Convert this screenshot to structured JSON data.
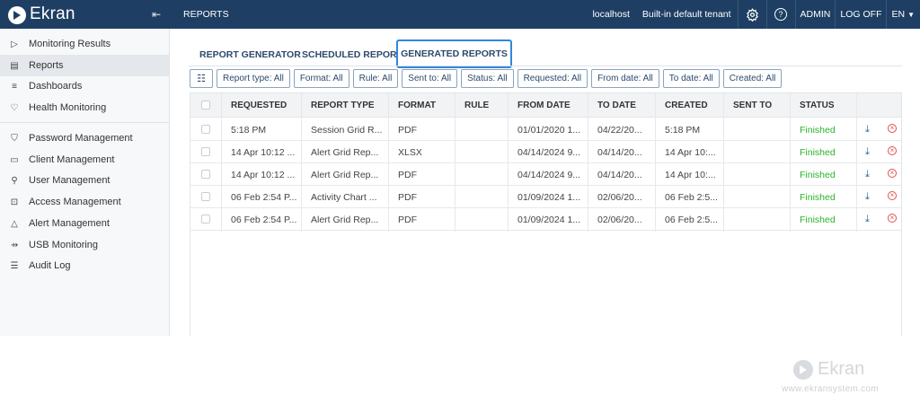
{
  "app": {
    "logo": "Ekran",
    "page_title": "REPORTS"
  },
  "topbar": {
    "host": "localhost",
    "tenant": "Built-in default tenant",
    "settings_icon": "gear-icon",
    "help_icon": "question-circle-icon",
    "admin": "ADMIN",
    "logoff": "LOG OFF",
    "language": "EN"
  },
  "sidebar": {
    "items": [
      {
        "label": "Monitoring Results",
        "icon": "play-outline-icon"
      },
      {
        "label": "Reports",
        "icon": "document-icon"
      },
      {
        "label": "Dashboards",
        "icon": "bar-chart-icon"
      },
      {
        "label": "Health Monitoring",
        "icon": "heart-icon"
      },
      {
        "label": "Password Management",
        "icon": "shield-icon"
      },
      {
        "label": "Client Management",
        "icon": "monitor-icon"
      },
      {
        "label": "User Management",
        "icon": "user-icon"
      },
      {
        "label": "Access Management",
        "icon": "lock-icon"
      },
      {
        "label": "Alert Management",
        "icon": "bell-icon"
      },
      {
        "label": "USB Monitoring",
        "icon": "usb-icon"
      },
      {
        "label": "Audit Log",
        "icon": "list-icon"
      }
    ]
  },
  "tabs": [
    {
      "label": "REPORT GENERATOR"
    },
    {
      "label": "SCHEDULED REPORTS"
    },
    {
      "label": "GENERATED REPORTS"
    }
  ],
  "filters": [
    "Report type: All",
    "Format: All",
    "Rule: All",
    "Sent to: All",
    "Status: All",
    "Requested: All",
    "From date: All",
    "To date: All",
    "Created: All"
  ],
  "table": {
    "headers": [
      "REQUESTED",
      "REPORT TYPE",
      "FORMAT",
      "RULE",
      "FROM DATE",
      "TO DATE",
      "CREATED",
      "SENT TO",
      "STATUS"
    ],
    "rows": [
      {
        "requested": "5:18 PM",
        "report_type": "Session Grid R...",
        "format": "PDF",
        "rule": "",
        "from_date": "01/01/2020 1...",
        "to_date": "04/22/20...",
        "created": "5:18 PM",
        "sent_to": "",
        "status": "Finished"
      },
      {
        "requested": "14 Apr 10:12 ...",
        "report_type": "Alert Grid Rep...",
        "format": "XLSX",
        "rule": "",
        "from_date": "04/14/2024 9...",
        "to_date": "04/14/20...",
        "created": "14 Apr 10:...",
        "sent_to": "",
        "status": "Finished"
      },
      {
        "requested": "14 Apr 10:12 ...",
        "report_type": "Alert Grid Rep...",
        "format": "PDF",
        "rule": "",
        "from_date": "04/14/2024 9...",
        "to_date": "04/14/20...",
        "created": "14 Apr 10:...",
        "sent_to": "",
        "status": "Finished"
      },
      {
        "requested": "06 Feb 2:54 P...",
        "report_type": "Activity Chart ...",
        "format": "PDF",
        "rule": "",
        "from_date": "01/09/2024 1...",
        "to_date": "02/06/20...",
        "created": "06 Feb 2:5...",
        "sent_to": "",
        "status": "Finished"
      },
      {
        "requested": "06 Feb 2:54 P...",
        "report_type": "Alert Grid Rep...",
        "format": "PDF",
        "rule": "",
        "from_date": "01/09/2024 1...",
        "to_date": "02/06/20...",
        "created": "06 Feb 2:5...",
        "sent_to": "",
        "status": "Finished"
      }
    ]
  },
  "watermark": {
    "logo": "Ekran",
    "url": "www.ekransystem.com"
  },
  "colors": {
    "topbar": "#1e3f63",
    "accent": "#2f86e0",
    "status_ok": "#2ab32a",
    "remove": "#e0504e"
  }
}
